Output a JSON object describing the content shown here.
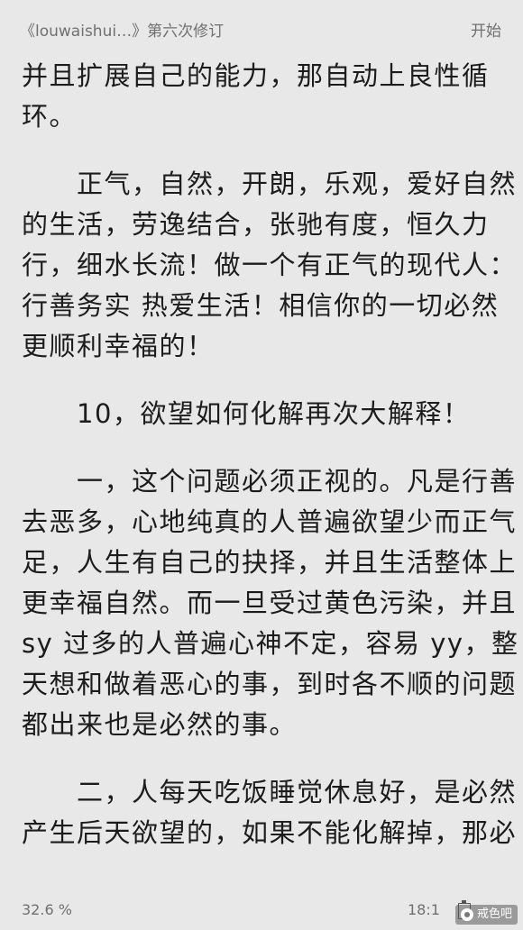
{
  "header": {
    "book_title": "《louwaishui…》第六次修订",
    "start_label": "开始"
  },
  "content": {
    "lines": [
      {
        "text": "并且扩展自己的能力，那自动上良性循",
        "gap": 0
      },
      {
        "text": "环。",
        "gap": 0
      },
      {
        "text": "　　正气，自然，开朗，乐观，爱好自然",
        "gap": 30
      },
      {
        "text": "的生活，劳逸结合，张驰有度，恒久力",
        "gap": 0
      },
      {
        "text": "行，细水长流！做一个有正气的现代人：",
        "gap": 0
      },
      {
        "text": "行善务实 热爱生活！相信你的一切必然",
        "gap": 0
      },
      {
        "text": "更顺利幸福的！",
        "gap": 0
      },
      {
        "text": "　　10，欲望如何化解再次大解释！",
        "gap": 30
      },
      {
        "text": "　　一，这个问题必须正视的。凡是行善",
        "gap": 30
      },
      {
        "text": "去恶多，心地纯真的人普遍欲望少而正气",
        "gap": 0
      },
      {
        "text": "足，人生有自己的抉择，并且生活整体上",
        "gap": 0
      },
      {
        "text": "更幸福自然。而一旦受过黄色污染，并且",
        "gap": 0
      },
      {
        "text": "sy 过多的人普遍心神不定，容易 yy，整",
        "gap": 0
      },
      {
        "text": "天想和做着恶心的事，到时各不顺的问题",
        "gap": 0
      },
      {
        "text": "都出来也是必然的事。",
        "gap": 0
      },
      {
        "text": "　　二，人每天吃饭睡觉休息好，是必然",
        "gap": 30
      },
      {
        "text": "产生后天欲望的，如果不能化解掉，那必",
        "gap": 0
      }
    ]
  },
  "footer": {
    "progress": "32.6 %",
    "time": "18:1"
  },
  "watermark": {
    "text": "戒色吧"
  }
}
